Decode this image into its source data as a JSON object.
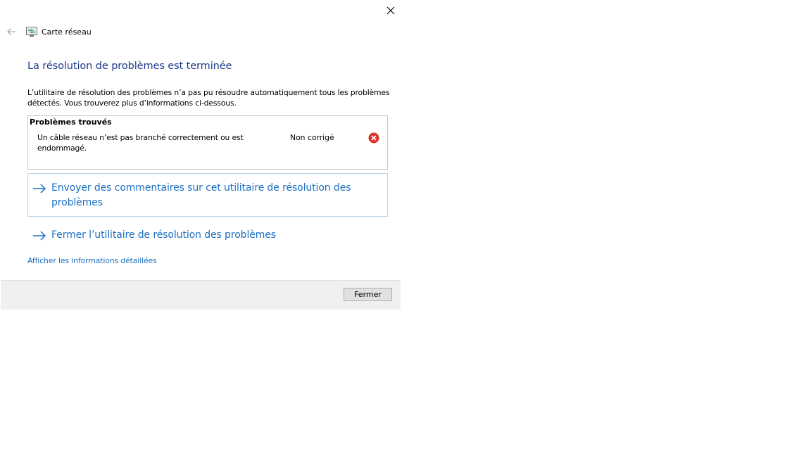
{
  "window": {
    "title": "Carte réseau",
    "app_icon": "network-adapter-icon",
    "close_icon": "close-icon",
    "back_icon": "back-arrow-icon"
  },
  "main": {
    "heading": "La résolution de problèmes est terminée",
    "description": "L’utilitaire de résolution des problèmes n’a pas pu résoudre automatiquement tous les problèmes détectés. Vous trouverez plus d’informations ci-dessous.",
    "problems": {
      "title": "Problèmes trouvés",
      "items": [
        {
          "text": "Un câble réseau n’est pas branché correctement ou est endommagé.",
          "status": "Non corrigé",
          "status_icon": "error-icon"
        }
      ]
    },
    "links": [
      {
        "label": "Envoyer des commentaires sur cet utilitaire de résolution des problèmes",
        "icon": "arrow-right-icon"
      },
      {
        "label": "Fermer l’utilitaire de résolution des problèmes",
        "icon": "arrow-right-icon"
      }
    ],
    "details_link": "Afficher les informations détaillées"
  },
  "footer": {
    "close_button": "Fermer"
  },
  "colors": {
    "heading": "#1e3a8c",
    "link": "#1a6fc4",
    "error": "#d9342b",
    "footer_bg": "#f0f0f0"
  }
}
